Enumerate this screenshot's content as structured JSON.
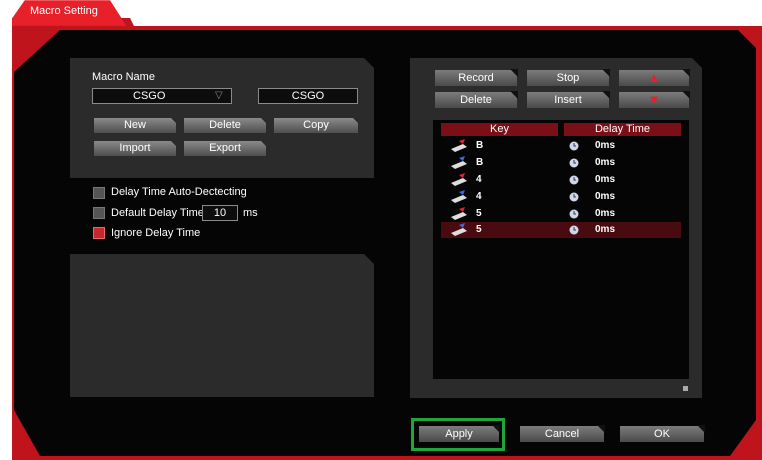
{
  "window": {
    "tab_title": "Macro Setting"
  },
  "macro": {
    "name_label": "Macro Name",
    "selected_macro": "CSGO",
    "name_input": "CSGO",
    "buttons": {
      "new": "New",
      "delete": "Delete",
      "copy": "Copy",
      "import": "Import",
      "export": "Export"
    }
  },
  "options": {
    "auto_detect_label": "Delay Time Auto-Dectecting",
    "default_delay_label": "Default Delay Time",
    "default_delay_value": "10",
    "default_delay_unit": "ms",
    "ignore_delay_label": "Ignore Delay Time",
    "auto_detect_checked": false,
    "default_delay_checked": false,
    "ignore_delay_checked": true
  },
  "record": {
    "buttons": {
      "record": "Record",
      "stop": "Stop",
      "delete": "Delete",
      "insert": "Insert"
    },
    "table": {
      "headers": {
        "key": "Key",
        "delay": "Delay Time"
      },
      "rows": [
        {
          "key": "B",
          "delay": "0ms",
          "action": "press"
        },
        {
          "key": "B",
          "delay": "0ms",
          "action": "release"
        },
        {
          "key": "4",
          "delay": "0ms",
          "action": "press"
        },
        {
          "key": "4",
          "delay": "0ms",
          "action": "release"
        },
        {
          "key": "5",
          "delay": "0ms",
          "action": "press"
        },
        {
          "key": "5",
          "delay": "0ms",
          "action": "release"
        }
      ],
      "selected_row": 5
    }
  },
  "footer": {
    "apply": "Apply",
    "cancel": "Cancel",
    "ok": "OK"
  },
  "colors": {
    "accent": "#e8202a",
    "highlight": "#1fa53a",
    "header": "#7a0f18",
    "selected_row": "#4a0b10"
  }
}
